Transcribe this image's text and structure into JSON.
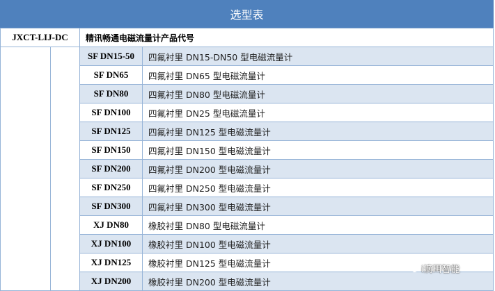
{
  "title": "选型表",
  "header": {
    "model": "JXCT-LIJ-DC",
    "name": "精讯畅通电磁流量计产品代号"
  },
  "rows": [
    {
      "code": "SF DN15-50",
      "desc": "四氟衬里 DN15-DN50 型电磁流量计"
    },
    {
      "code": "SF DN65",
      "desc": "四氟衬里 DN65 型电磁流量计"
    },
    {
      "code": "SF DN80",
      "desc": "四氟衬里 DN80 型电磁流量计"
    },
    {
      "code": "SF DN100",
      "desc": "四氟衬里 DN25 型电磁流量计"
    },
    {
      "code": "SF DN125",
      "desc": "四氟衬里 DN125 型电磁流量计"
    },
    {
      "code": "SF DN150",
      "desc": "四氟衬里 DN150 型电磁流量计"
    },
    {
      "code": "SF DN200",
      "desc": "四氟衬里 DN200 型电磁流量计"
    },
    {
      "code": "SF DN250",
      "desc": "四氟衬里 DN250 型电磁流量计"
    },
    {
      "code": "SF DN300",
      "desc": "四氟衬里 DN300 型电磁流量计"
    },
    {
      "code": "XJ DN80",
      "desc": "橡胶衬里 DN80 型电磁流量计"
    },
    {
      "code": "XJ DN100",
      "desc": "橡胶衬里  DN100 型电磁流量计"
    },
    {
      "code": "XJ DN125",
      "desc": "橡胶衬里  DN125 型电磁流量计"
    },
    {
      "code": "XJ DN200",
      "desc": "橡胶衬里  DN200 型电磁流量计"
    }
  ],
  "watermark": {
    "text": "i滴珥智能",
    "icon": "wechat-icon"
  },
  "colors": {
    "header_bar": "#4f81bd",
    "row_tint": "#dbe5f1",
    "border": "#95b3d7"
  }
}
